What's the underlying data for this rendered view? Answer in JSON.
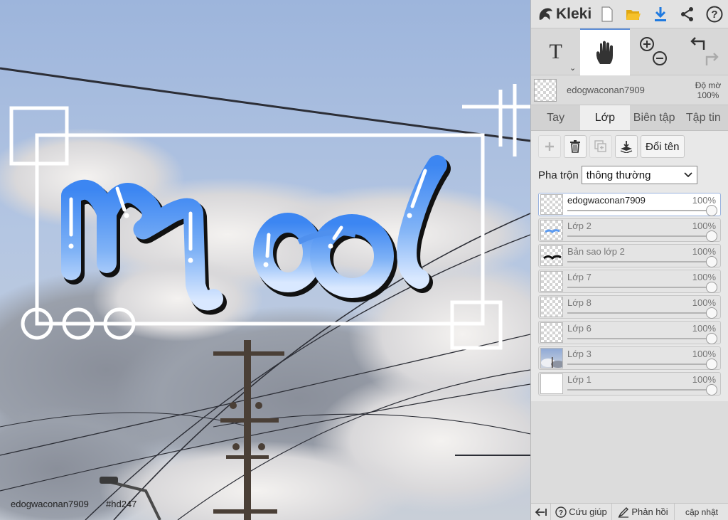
{
  "app": {
    "name": "Kleki"
  },
  "topbar": {
    "icons": [
      "new-file-icon",
      "open-folder-icon",
      "download-icon",
      "share-icon",
      "help-icon"
    ],
    "accent": "#1f7ae0",
    "folder_color": "#f2b820"
  },
  "tools": {
    "text_label": "T",
    "items": [
      "text-tool",
      "hand-tool",
      "zoom-in",
      "zoom-out",
      "undo",
      "redo"
    ],
    "active": "hand-tool"
  },
  "current_layer": {
    "name": "edogwaconan7909",
    "opacity_label": "Độ mờ",
    "opacity_value": "100%"
  },
  "tabs": [
    {
      "label": "Tay",
      "active": false
    },
    {
      "label": "Lớp",
      "active": true
    },
    {
      "label": "Biên tập",
      "active": false
    },
    {
      "label": "Tập tin",
      "active": false
    }
  ],
  "layer_tools": {
    "rename_label": "Đổi tên",
    "icons": [
      "add-layer-icon",
      "delete-layer-icon",
      "duplicate-layer-icon",
      "merge-down-icon"
    ]
  },
  "blend": {
    "label": "Pha trộn",
    "selected": "thông thường"
  },
  "layers": [
    {
      "name": "edogwaconan7909",
      "opacity": "100%",
      "opacity_value": 1.0,
      "active": true
    },
    {
      "name": "Lớp 2",
      "opacity": "100%",
      "opacity_value": 1.0,
      "active": false
    },
    {
      "name": "Bản sao lớp 2",
      "opacity": "100%",
      "opacity_value": 1.0,
      "active": false
    },
    {
      "name": "Lớp 7",
      "opacity": "100%",
      "opacity_value": 1.0,
      "active": false
    },
    {
      "name": "Lớp 8",
      "opacity": "100%",
      "opacity_value": 1.0,
      "active": false
    },
    {
      "name": "Lớp 6",
      "opacity": "100%",
      "opacity_value": 1.0,
      "active": false
    },
    {
      "name": "Lớp 3",
      "opacity": "100%",
      "opacity_value": 1.0,
      "active": false
    },
    {
      "name": "Lớp 1",
      "opacity": "100%",
      "opacity_value": 1.0,
      "active": false
    }
  ],
  "bottombar": {
    "help": "Cứu giúp",
    "feedback": "Phản hồi",
    "update": "cập nhật"
  },
  "canvas": {
    "artwork_text": "mood",
    "caption_user": "edogwaconan7909",
    "caption_tag": "#hd247",
    "sky_color": "#a3b9de",
    "lettering_color": "#5b9af0"
  }
}
